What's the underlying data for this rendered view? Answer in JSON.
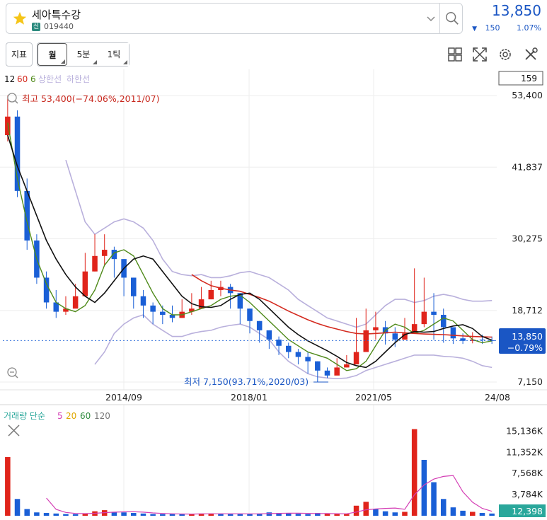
{
  "header": {
    "stock_name": "세아특수강",
    "badge": "신",
    "stock_code": "019440",
    "price": "13,850",
    "change_arrow": "▼",
    "change_value": "150",
    "change_pct": "1.07%"
  },
  "toolbar": {
    "indicator_label": "지표",
    "period_month": "월",
    "period_5min": "5분",
    "period_1tick": "1틱"
  },
  "colors": {
    "up": "#e0241b",
    "down": "#1a5fd6",
    "ma12": "#111111",
    "ma60": "#d42a1f",
    "ma6": "#4f8a1a",
    "band": "#b9b0dc",
    "price_blue": "#1a56c4",
    "vol_badge": "#2aa79b"
  },
  "chart_data": [
    {
      "type": "candlestick",
      "legend": {
        "ma_a": "12",
        "ma_b": "60",
        "ma_c": "6",
        "band_upper": "상한선",
        "band_lower": "하한선"
      },
      "candle_count_label": "159",
      "y_ticks": [
        "53,400",
        "41,837",
        "30,275",
        "18,712",
        "7,150"
      ],
      "y_tick_values": [
        53400,
        41837,
        30275,
        18712,
        7150
      ],
      "ylim": [
        7150,
        53400
      ],
      "x_ticks": [
        "2014/09",
        "2018/01",
        "2021/05",
        "24/08"
      ],
      "annotations": {
        "high": "최고 53,400(−74.06%,2011/07)",
        "low": "최저 7,150(93.71%,2020/03)"
      },
      "current_price": "13,850",
      "current_change": "−0.79%",
      "current_value": 13850,
      "months_from": "2011/07",
      "ma12": [
        47000,
        42000,
        38000,
        34000,
        30000,
        27000,
        24500,
        22500,
        21000,
        20000,
        21500,
        23500,
        25500,
        27000,
        27500,
        27000,
        25000,
        23000,
        21000,
        19800,
        19300,
        19200,
        19500,
        20500,
        21300,
        21500,
        20500,
        19000,
        17500,
        16000,
        14800,
        13800,
        13000,
        12200,
        11300,
        10300,
        9800,
        9500,
        10500,
        12000,
        13500,
        14800,
        15300,
        15200,
        15300,
        15800,
        16200,
        16400,
        15800,
        14500,
        13900
      ],
      "ma60": [
        null,
        null,
        null,
        null,
        null,
        null,
        null,
        null,
        null,
        null,
        null,
        null,
        null,
        null,
        null,
        null,
        null,
        null,
        null,
        24500,
        23500,
        22700,
        22300,
        22000,
        21800,
        21300,
        20800,
        20200,
        19400,
        18600,
        17900,
        17200,
        16600,
        16100,
        15700,
        15300,
        15000,
        14900,
        15000,
        15100,
        15200,
        15100,
        15000,
        14900,
        14850,
        14800,
        14700,
        14600,
        14500,
        14450,
        14400
      ],
      "ma6": [
        49000,
        40000,
        33000,
        27000,
        23000,
        20000,
        19000,
        18500,
        19500,
        22000,
        26000,
        28000,
        28500,
        27500,
        24500,
        21500,
        19000,
        18000,
        18000,
        18500,
        19000,
        19500,
        20500,
        21000,
        21200,
        20000,
        18500,
        17000,
        15500,
        14000,
        13000,
        12000,
        11500,
        11000,
        10000,
        9000,
        9300,
        10500,
        13000,
        15500,
        16500,
        16000,
        15000,
        15500,
        16500,
        17500,
        17000,
        15500,
        14000,
        13500,
        13800
      ],
      "band_upper": [
        null,
        null,
        null,
        null,
        null,
        null,
        43000,
        38000,
        33000,
        31000,
        32000,
        33000,
        33500,
        33000,
        32000,
        30000,
        27000,
        25000,
        24500,
        24300,
        24500,
        24000,
        24000,
        24300,
        24800,
        25000,
        24500,
        24000,
        23000,
        22000,
        20500,
        19500,
        18500,
        17500,
        17000,
        16500,
        16000,
        16500,
        18000,
        19500,
        20500,
        20500,
        20000,
        20300,
        21000,
        21300,
        21000,
        20500,
        20200,
        20200,
        20300
      ],
      "band_lower": [
        null,
        null,
        null,
        null,
        null,
        null,
        null,
        null,
        null,
        10000,
        12000,
        15000,
        16500,
        17500,
        18000,
        16500,
        15500,
        14500,
        14500,
        15000,
        15300,
        15500,
        16000,
        16300,
        16500,
        16000,
        15000,
        14000,
        12000,
        10500,
        9500,
        8500,
        8000,
        7800,
        7700,
        7800,
        8200,
        9000,
        9500,
        10000,
        10500,
        11000,
        11500,
        11500,
        11500,
        11300,
        11200,
        11000,
        10500,
        9800,
        9500
      ],
      "close": [
        50000,
        38000,
        30000,
        24000,
        20000,
        18500,
        19000,
        21000,
        25000,
        27500,
        28500,
        27000,
        24000,
        21000,
        19500,
        18500,
        18000,
        17500,
        18500,
        19000,
        20500,
        22000,
        22500,
        21500,
        19000,
        17000,
        15500,
        14000,
        13000,
        12000,
        11200,
        10500,
        9000,
        8200,
        9500,
        10000,
        12000,
        15500,
        16000,
        15000,
        14000,
        15000,
        16500,
        18500,
        18000,
        16000,
        14200,
        13800,
        14000,
        13900,
        13850
      ],
      "high": [
        53400,
        51000,
        40000,
        31000,
        25000,
        22000,
        21000,
        23000,
        28000,
        31000,
        31000,
        29000,
        27000,
        24000,
        22000,
        20000,
        19500,
        19500,
        20500,
        21500,
        22500,
        23500,
        23500,
        23000,
        21500,
        19000,
        17000,
        15500,
        14500,
        13500,
        12500,
        12000,
        10500,
        9500,
        11000,
        11500,
        17500,
        19000,
        18500,
        17000,
        16000,
        17500,
        25500,
        24000,
        21500,
        19000,
        15500,
        15000,
        15200,
        14800,
        14500
      ],
      "low": [
        46000,
        37000,
        28500,
        23000,
        19000,
        17500,
        18000,
        19500,
        22500,
        25000,
        26000,
        24000,
        21000,
        19000,
        17500,
        16500,
        16500,
        16800,
        17500,
        18000,
        19500,
        20500,
        21000,
        19000,
        16500,
        15000,
        13500,
        12500,
        11500,
        11000,
        10000,
        8500,
        7150,
        7800,
        8500,
        9500,
        11000,
        13500,
        14000,
        13200,
        12800,
        14000,
        15500,
        16000,
        14000,
        13500,
        13300,
        13300,
        13400,
        13300,
        13300
      ],
      "open": [
        47000,
        50000,
        38000,
        30000,
        24000,
        20000,
        18500,
        19000,
        21000,
        25000,
        27500,
        28500,
        27000,
        24000,
        21000,
        19500,
        18500,
        18000,
        17500,
        18500,
        19000,
        20500,
        22000,
        22500,
        21500,
        19000,
        17000,
        15500,
        14000,
        13000,
        12000,
        11200,
        10500,
        9000,
        8200,
        9500,
        10000,
        12000,
        15500,
        16000,
        15000,
        14000,
        15000,
        16500,
        18500,
        18000,
        16000,
        14200,
        13800,
        14000,
        13900
      ]
    },
    {
      "type": "bar",
      "legend": {
        "title": "거래량 단순",
        "ma5": "5",
        "ma20": "20",
        "ma60": "60",
        "ma120": "120"
      },
      "y_ticks": [
        "15,136K",
        "11,352K",
        "7,568K",
        "3,784K"
      ],
      "y_tick_values": [
        15136,
        11352,
        7568,
        3784
      ],
      "ylim": [
        0,
        16200
      ],
      "current_volume": "12,398",
      "values": [
        10500,
        3000,
        1200,
        600,
        500,
        400,
        300,
        300,
        400,
        800,
        1000,
        700,
        600,
        500,
        400,
        300,
        300,
        300,
        300,
        350,
        400,
        400,
        350,
        300,
        300,
        350,
        400,
        600,
        500,
        400,
        350,
        300,
        500,
        400,
        300,
        300,
        1800,
        2500,
        1200,
        800,
        600,
        700,
        15500,
        10000,
        6000,
        3000,
        1500,
        900,
        700,
        500,
        400
      ],
      "up_flags": [
        1,
        0,
        0,
        0,
        0,
        0,
        0,
        0,
        1,
        1,
        1,
        0,
        0,
        0,
        0,
        0,
        0,
        0,
        0,
        1,
        1,
        1,
        0,
        0,
        0,
        0,
        0,
        0,
        0,
        0,
        0,
        0,
        0,
        1,
        1,
        1,
        1,
        1,
        0,
        0,
        0,
        1,
        1,
        0,
        0,
        0,
        0,
        0,
        1,
        0,
        0
      ]
    }
  ]
}
